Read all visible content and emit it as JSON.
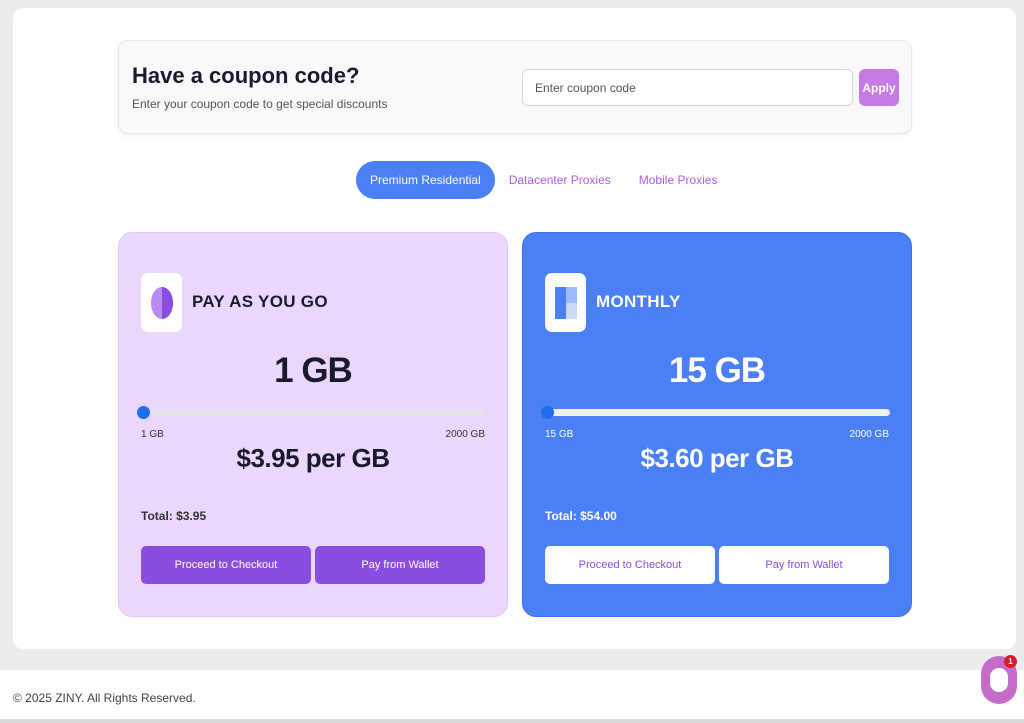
{
  "coupon": {
    "title": "Have a coupon code?",
    "subtitle": "Enter your coupon code to get special discounts",
    "placeholder": "Enter coupon code",
    "value": "",
    "apply_label": "Apply"
  },
  "tabs": [
    {
      "label": "Premium Residential",
      "active": true
    },
    {
      "label": "Datacenter Proxies",
      "active": false
    },
    {
      "label": "Mobile Proxies",
      "active": false
    }
  ],
  "plans": [
    {
      "name": "PAY AS YOU GO",
      "icon": "half-circle-icon",
      "amount": "1 GB",
      "slider_value": 1,
      "slider_min_label": "1 GB",
      "slider_max_label": "2000 GB",
      "price": "$3.95 per GB",
      "total": "Total: $3.95",
      "checkout_label": "Proceed to Checkout",
      "wallet_label": "Pay from Wallet"
    },
    {
      "name": "MONTHLY",
      "icon": "calendar-blocks-icon",
      "amount": "15 GB",
      "slider_value": 15,
      "slider_min_label": "15 GB",
      "slider_max_label": "2000 GB",
      "price": "$3.60 per GB",
      "total": "Total: $54.00",
      "checkout_label": "Proceed to Checkout",
      "wallet_label": "Pay from Wallet"
    }
  ],
  "footer": {
    "copyright": "© 2025 ZINY. All Rights Reserved."
  },
  "chat": {
    "badge_count": "1"
  },
  "colors": {
    "accent_blue": "#4a7ff5",
    "accent_purple": "#8a4ddf",
    "card_lavender": "#ead7fb",
    "apply_purple": "#c67ae6"
  }
}
